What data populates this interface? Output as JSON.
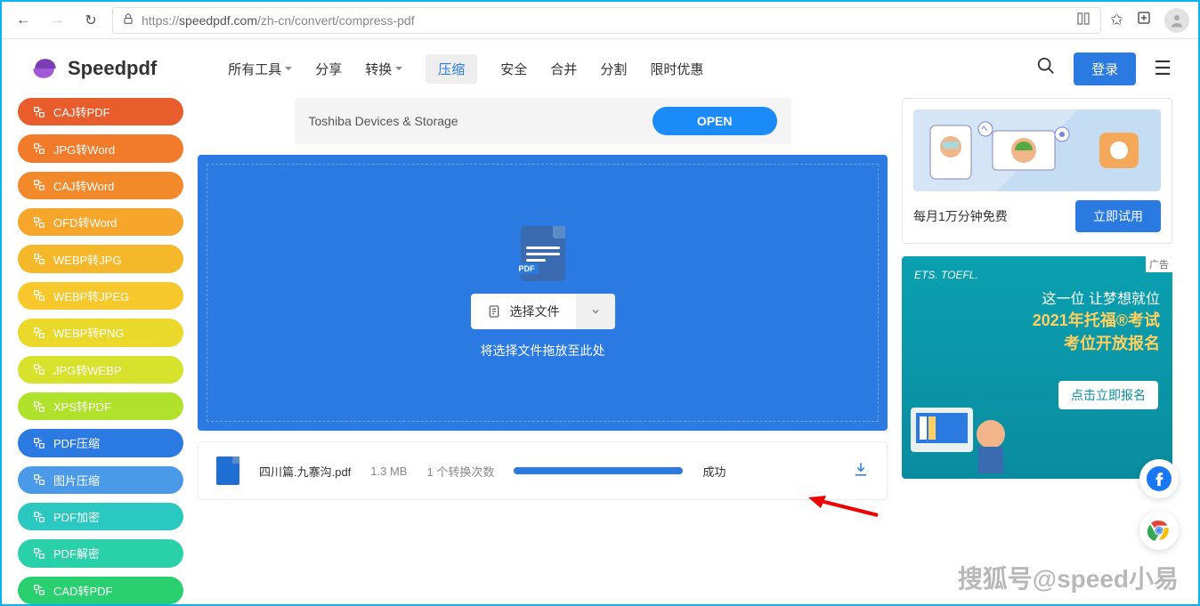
{
  "browser": {
    "url_prefix": "https://",
    "url_domain": "speedpdf.com",
    "url_path": "/zh-cn/convert/compress-pdf"
  },
  "brand": "Speedpdf",
  "nav": {
    "all_tools": "所有工具",
    "share": "分享",
    "convert": "转换",
    "compress": "压缩",
    "secure": "安全",
    "merge": "合并",
    "split": "分割",
    "promo": "限时优惠"
  },
  "header": {
    "login": "登录"
  },
  "sidebar": [
    {
      "label": "CAJ转PDF",
      "color": "#e95c2b"
    },
    {
      "label": "JPG转Word",
      "color": "#f27a2b"
    },
    {
      "label": "CAJ转Word",
      "color": "#f28a2b"
    },
    {
      "label": "OFD转Word",
      "color": "#f6a62b"
    },
    {
      "label": "WEBP转JPG",
      "color": "#f6b82b"
    },
    {
      "label": "WEBP转JPEG",
      "color": "#f6c82b"
    },
    {
      "label": "WEBP转PNG",
      "color": "#ead82b"
    },
    {
      "label": "JPG转WEBP",
      "color": "#d6e22b"
    },
    {
      "label": "XPS转PDF",
      "color": "#b0e22b"
    },
    {
      "label": "PDF压缩",
      "color": "#2a7ae2"
    },
    {
      "label": "图片压缩",
      "color": "#4a9ae8"
    },
    {
      "label": "PDF加密",
      "color": "#2ac8c0"
    },
    {
      "label": "PDF解密",
      "color": "#2ad0a8"
    },
    {
      "label": "CAD转PDF",
      "color": "#2ad070"
    }
  ],
  "ad_banner": {
    "text": "Toshiba Devices & Storage",
    "button": "OPEN"
  },
  "dropzone": {
    "pdf_badge": "PDF",
    "choose_file": "选择文件",
    "hint": "将选择文件拖放至此处"
  },
  "file": {
    "name": "四川篇.九寨沟.pdf",
    "size": "1.3 MB",
    "conversions": "1 个转换次数",
    "status": "成功"
  },
  "promo1": {
    "text": "每月1万分钟免费",
    "button": "立即试用"
  },
  "promo2": {
    "ad_label": "广告",
    "brand": "ETS. TOEFL.",
    "line1": "这一位 让梦想就位",
    "line2": "2021年托福®考试",
    "line3": "考位开放报名",
    "button": "点击立即报名"
  },
  "watermark": "搜狐号@speed小易"
}
